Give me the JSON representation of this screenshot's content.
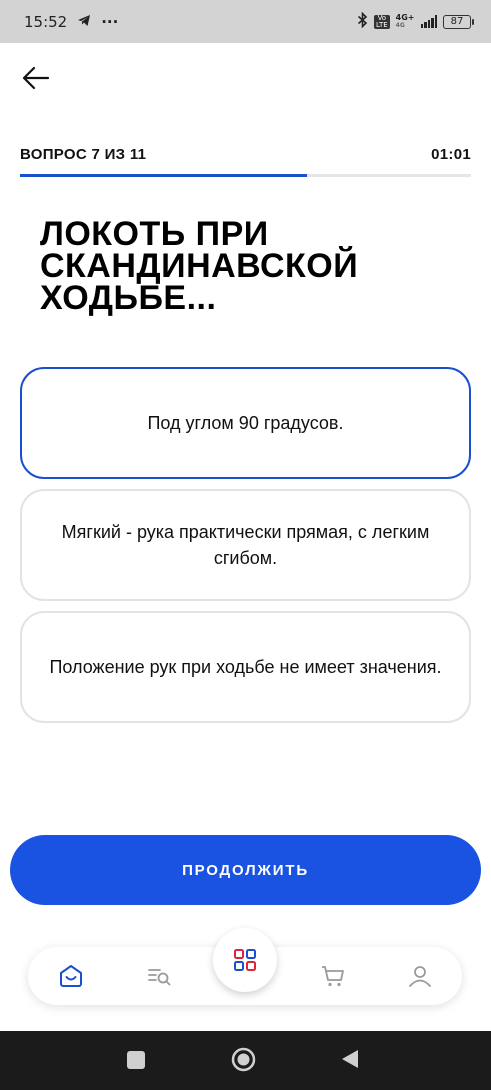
{
  "status_bar": {
    "time": "15:52",
    "dots": "···",
    "net_top": "4G+",
    "net_bottom": "4G",
    "volte_top": "Vo",
    "volte_bottom": "LTE",
    "battery": "87"
  },
  "header": {
    "question_counter": "ВОПРОС 7 ИЗ 11",
    "timer": "01:01",
    "progress": 0.636
  },
  "question": {
    "text": "ЛОКОТЬ ПРИ СКАНДИНАВСКОЙ ХОДЬБЕ..."
  },
  "options": [
    {
      "label": "Под углом 90 градусов.",
      "selected": true
    },
    {
      "label": "Мягкий - рука практически прямая, с легким сгибом.",
      "selected": false
    },
    {
      "label": "Положение рук при ходьбе не имеет значения.",
      "selected": false
    }
  ],
  "continue_label": "ПРОДОЛЖИТЬ",
  "tabbar": {
    "items": [
      {
        "icon": "home-icon",
        "active": true
      },
      {
        "icon": "search-list-icon",
        "active": false
      },
      {
        "icon": "catalog-grid-icon",
        "active": false
      },
      {
        "icon": "cart-icon",
        "active": false
      },
      {
        "icon": "profile-icon",
        "active": false
      }
    ]
  },
  "colors": {
    "accent": "#1a53e2",
    "selected_border": "#1a4fd0",
    "grid_red": "#d8263a",
    "grid_blue": "#1a4fd0"
  }
}
